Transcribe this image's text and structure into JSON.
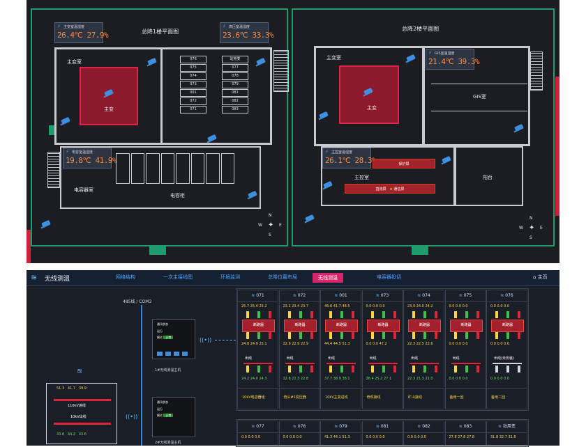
{
  "plan": {
    "floor1_title": "总降1楼平面图",
    "floor2_title": "总降2楼平面图",
    "rooms": {
      "main_transformer_1": "主变室",
      "main_transformer_label_1": "主变",
      "capacitor_room": "电容器室",
      "capacitor_cabinet": "电容柜",
      "main_transformer_2": "主变室",
      "main_transformer_label_2": "主变",
      "gis_room": "GIS室",
      "control_room": "主控室",
      "balcony": "阳台",
      "protection_screen": "保护屏",
      "dc_screen": "直流屏",
      "comm_screen": "通信屏"
    },
    "sensors": [
      {
        "name": "主变室温湿度",
        "value": "26.4℃ 27.9%"
      },
      {
        "name": "高压室温湿度",
        "value": "23.6℃ 33.3%"
      },
      {
        "name": "电容室温湿度",
        "value": "19.8℃ 41.9%"
      },
      {
        "name": "GIS室温湿度",
        "value": "21.4℃ 39.3%"
      },
      {
        "name": "主控室温湿度",
        "value": "26.1℃ 28.3%"
      }
    ],
    "cabinets_left": [
      "076",
      "075",
      "074",
      "073",
      "001",
      "072",
      "071"
    ],
    "cabinets_right": [
      "站用变",
      "077",
      "078",
      "079",
      "081",
      "082",
      "083"
    ],
    "compass": {
      "n": "N",
      "s": "S",
      "e": "E",
      "w": "W"
    }
  },
  "wt": {
    "title": "无线测温",
    "nav": [
      "网络结构",
      "一次主接线图",
      "环境监测",
      "总降位置布局",
      "无线测温",
      "电容器投切"
    ],
    "home": "主页",
    "bus": "485线 / COM3",
    "host1": "1#无线测温主机",
    "host2": "2#无线测温主机",
    "device_labels": {
      "comm": "通讯状态",
      "run": "运行",
      "mode": "模式",
      "normal": "正常"
    },
    "left_box": {
      "vals_top": [
        "51.3",
        "41.7",
        "39.9"
      ],
      "in_label": "110kV进线",
      "out_label": "10kV出线",
      "vals_bot": [
        "43.6",
        "44.2",
        "43.6"
      ]
    },
    "nodes_row1": [
      {
        "id": "071",
        "t1": [
          "25.7",
          "25.4",
          "25.2"
        ],
        "t2": [
          "24.8",
          "24.9",
          "25.1"
        ],
        "t3": [
          "24.2",
          "24.0",
          "24.3"
        ],
        "out": "出线",
        "foot": "10kV电容器组"
      },
      {
        "id": "072",
        "t1": [
          "23.2",
          "23.4",
          "23.7"
        ],
        "t2": [
          "22.9",
          "22.9",
          "22.9"
        ],
        "t3": [
          "22.8",
          "22.3",
          "22.8"
        ],
        "out": "出线",
        "foot": "奇头#1变压器"
      },
      {
        "id": "001",
        "t1": [
          "46.6",
          "41.7",
          "48.5"
        ],
        "t2": [
          "44.4",
          "44.5",
          "51.3"
        ],
        "t3": [
          "37.7",
          "38.9",
          "38.1"
        ],
        "out": "出线",
        "foot": "10kV主变进线"
      },
      {
        "id": "073",
        "t1": [
          "0.0",
          "0.0",
          "0.0"
        ],
        "t2": [
          "0.0",
          "0.0",
          "47.2"
        ],
        "t3": [
          "26.4",
          "25.2",
          "27.1"
        ],
        "out": "出线",
        "foot": "奇现接线"
      },
      {
        "id": "074",
        "t1": [
          "23.9",
          "24.0",
          "24.2"
        ],
        "t2": [
          "22.3",
          "22.5",
          "22.6"
        ],
        "t3": [
          "22.3",
          "21.3",
          "22.0"
        ],
        "out": "出线",
        "foot": "矿山接线"
      },
      {
        "id": "075",
        "t1": [
          "0.0",
          "0.0",
          "0.0"
        ],
        "t2": [
          "0.0",
          "0.0",
          "0.0"
        ],
        "t3": [
          "0.0",
          "0.0",
          "0.0"
        ],
        "out": "出线",
        "foot": "备用一回"
      },
      {
        "id": "076",
        "t1": [
          "0.0",
          "0.0",
          "0.0"
        ],
        "t2": [
          "0.0",
          "0.0",
          "0.0"
        ],
        "t3": [
          "0.0",
          "0.0",
          "0.0"
        ],
        "out": "出线(未安装)",
        "foot": "备用二回"
      }
    ],
    "breaker": "断路器",
    "nodes_row2": [
      {
        "id": "077",
        "t1": [
          "0.0",
          "0.0",
          "0.0"
        ]
      },
      {
        "id": "078",
        "t1": [
          "0.0",
          "0.0",
          "0.0"
        ]
      },
      {
        "id": "079",
        "t1": [
          "41.3",
          "44.1",
          "51.3"
        ]
      },
      {
        "id": "081",
        "t1": [
          "0.0",
          "0.0",
          "0.0"
        ]
      },
      {
        "id": "082",
        "t1": [
          "0.0",
          "0.0",
          "0.0"
        ]
      },
      {
        "id": "083",
        "t1": [
          "27.8",
          "27.8",
          "27.8"
        ]
      },
      {
        "id": "站用变",
        "t1": [
          "31.8",
          "32.7",
          "31.8"
        ]
      }
    ]
  }
}
